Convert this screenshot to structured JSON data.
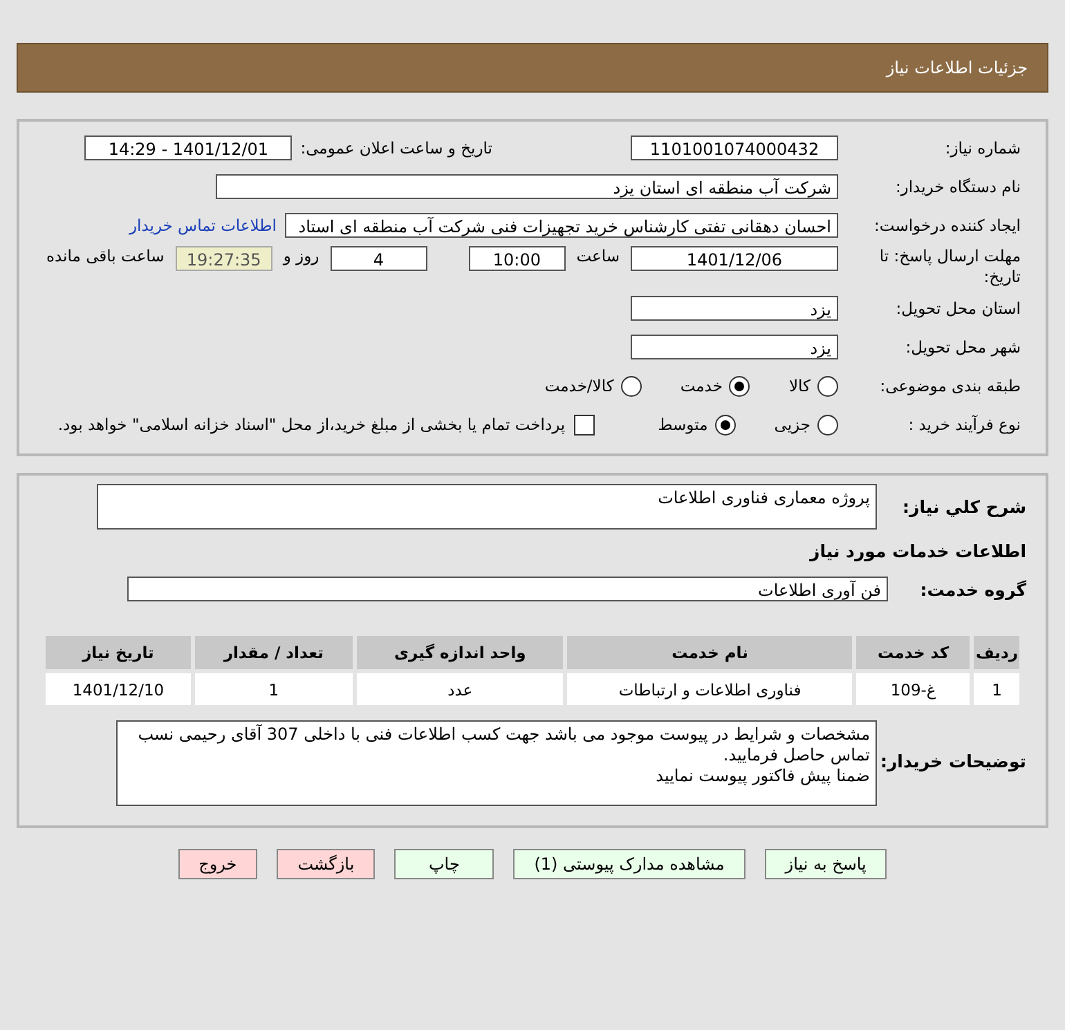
{
  "header": {
    "title": "جزئیات اطلاعات نیاز"
  },
  "details": {
    "need_number": {
      "label": "شماره نیاز:",
      "value": "1101001074000432"
    },
    "announce": {
      "label": "تاریخ و ساعت اعلان عمومی:",
      "value": "1401/12/01 - 14:29"
    },
    "buyer": {
      "label": "نام دستگاه خریدار:",
      "value": "شرکت آب منطقه ای استان یزد"
    },
    "requester": {
      "label": "ایجاد کننده درخواست:",
      "value": "احسان دهقانی تفتی کارشناس خرید تجهیزات فنی شرکت آب منطقه ای استاد",
      "link": "اطلاعات تماس خریدار"
    },
    "deadline": {
      "label_1": "مهلت ارسال پاسخ: تا",
      "label_2": "تاریخ:",
      "date": "1401/12/06",
      "time_label": "ساعت",
      "time": "10:00",
      "days": "4",
      "days_label": "روز و",
      "remaining": "19:27:35",
      "remaining_label": "ساعت باقی مانده"
    },
    "province": {
      "label": "استان محل تحویل:",
      "value": "یزد"
    },
    "city": {
      "label": "شهر محل تحویل:",
      "value": "یزد"
    },
    "category": {
      "label": "طبقه بندی موضوعی:",
      "options": [
        {
          "label": "کالا",
          "selected": false
        },
        {
          "label": "خدمت",
          "selected": true
        },
        {
          "label": "کالا/خدمت",
          "selected": false
        }
      ]
    },
    "process": {
      "label": "نوع فرآیند خرید :",
      "options": [
        {
          "label": "جزیی",
          "selected": false
        },
        {
          "label": "متوسط",
          "selected": true
        }
      ],
      "payment": {
        "checked": false,
        "text": "پرداخت تمام یا بخشی از مبلغ خرید،از محل \"اسناد خزانه اسلامی\" خواهد بود."
      }
    }
  },
  "summary": {
    "label": "شرح کلي نياز:",
    "value": "پروژه معماری فناوری اطلاعات"
  },
  "services_title": "اطلاعات خدمات مورد نیاز",
  "service_group": {
    "label": "گروه خدمت:",
    "value": "فن آوری اطلاعات"
  },
  "table": {
    "columns": [
      "ردیف",
      "کد خدمت",
      "نام خدمت",
      "واحد اندازه گیری",
      "تعداد / مقدار",
      "تاریخ نیاز"
    ],
    "rows": [
      [
        "1",
        "غ-109",
        "فناوری اطلاعات و ارتباطات",
        "عدد",
        "1",
        "1401/12/10"
      ]
    ]
  },
  "buyer_notes": {
    "label": "توضیحات خریدار:",
    "lines": [
      "مشخصات و شرایط در پیوست موجود می باشد جهت کسب اطلاعات فنی با داخلی 307 آقای رحیمی نسب تماس حاصل فرمایید.",
      "ضمنا پیش فاکتور پیوست نمایید"
    ]
  },
  "buttons": [
    {
      "label": "پاسخ به نیاز",
      "kind": "primary"
    },
    {
      "label": "مشاهده مدارک پیوستی (1)",
      "kind": "primary"
    },
    {
      "label": "چاپ",
      "kind": "primary"
    },
    {
      "label": "بازگشت",
      "kind": "danger"
    },
    {
      "label": "خروج",
      "kind": "danger"
    }
  ]
}
